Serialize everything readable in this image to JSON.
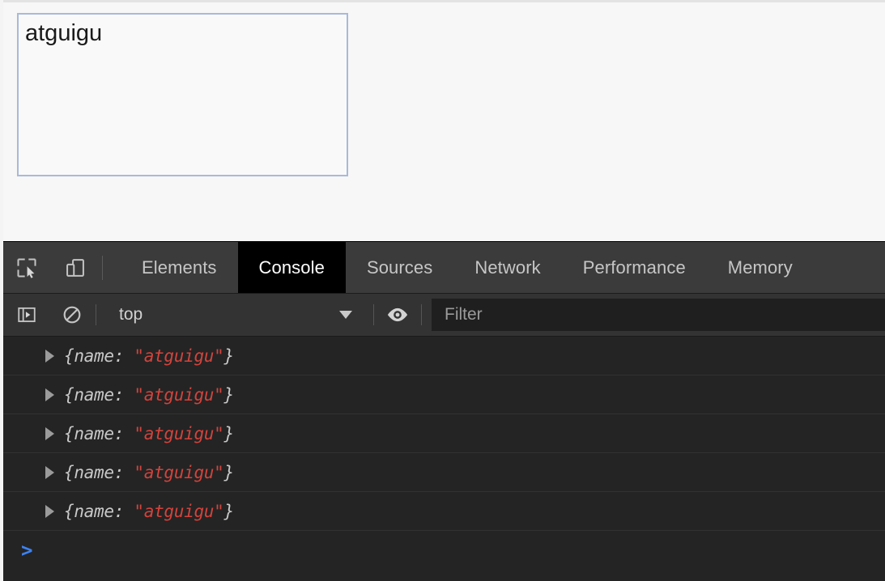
{
  "page": {
    "textarea": {
      "value": "atguigu",
      "placeholder": ""
    }
  },
  "devtools": {
    "tabbar": {
      "inspect_icon": "inspect-element-icon",
      "device_icon": "device-toolbar-icon",
      "tabs": [
        {
          "label": "Elements",
          "active": false
        },
        {
          "label": "Console",
          "active": true
        },
        {
          "label": "Sources",
          "active": false
        },
        {
          "label": "Network",
          "active": false
        },
        {
          "label": "Performance",
          "active": false
        },
        {
          "label": "Memory",
          "active": false
        }
      ]
    },
    "toolbar": {
      "sidebar_icon": "console-sidebar-icon",
      "clear_icon": "clear-console-icon",
      "context": "top",
      "eye_icon": "live-expression-eye-icon",
      "filter_placeholder": "Filter"
    },
    "console": {
      "messages": [
        {
          "prefix": "{name: ",
          "value": "\"atguigu\"",
          "suffix": "}"
        },
        {
          "prefix": "{name: ",
          "value": "\"atguigu\"",
          "suffix": "}"
        },
        {
          "prefix": "{name: ",
          "value": "\"atguigu\"",
          "suffix": "}"
        },
        {
          "prefix": "{name: ",
          "value": "\"atguigu\"",
          "suffix": "}"
        },
        {
          "prefix": "{name: ",
          "value": "\"atguigu\"",
          "suffix": "}"
        }
      ],
      "prompt": ">"
    }
  },
  "colors": {
    "string_value": "#d4433c",
    "prompt": "#3b82f6",
    "panel_bg": "#242424",
    "tabbar_bg": "#3b3b3b",
    "active_tab_bg": "#000000",
    "textarea_border": "#a9b9d9"
  }
}
